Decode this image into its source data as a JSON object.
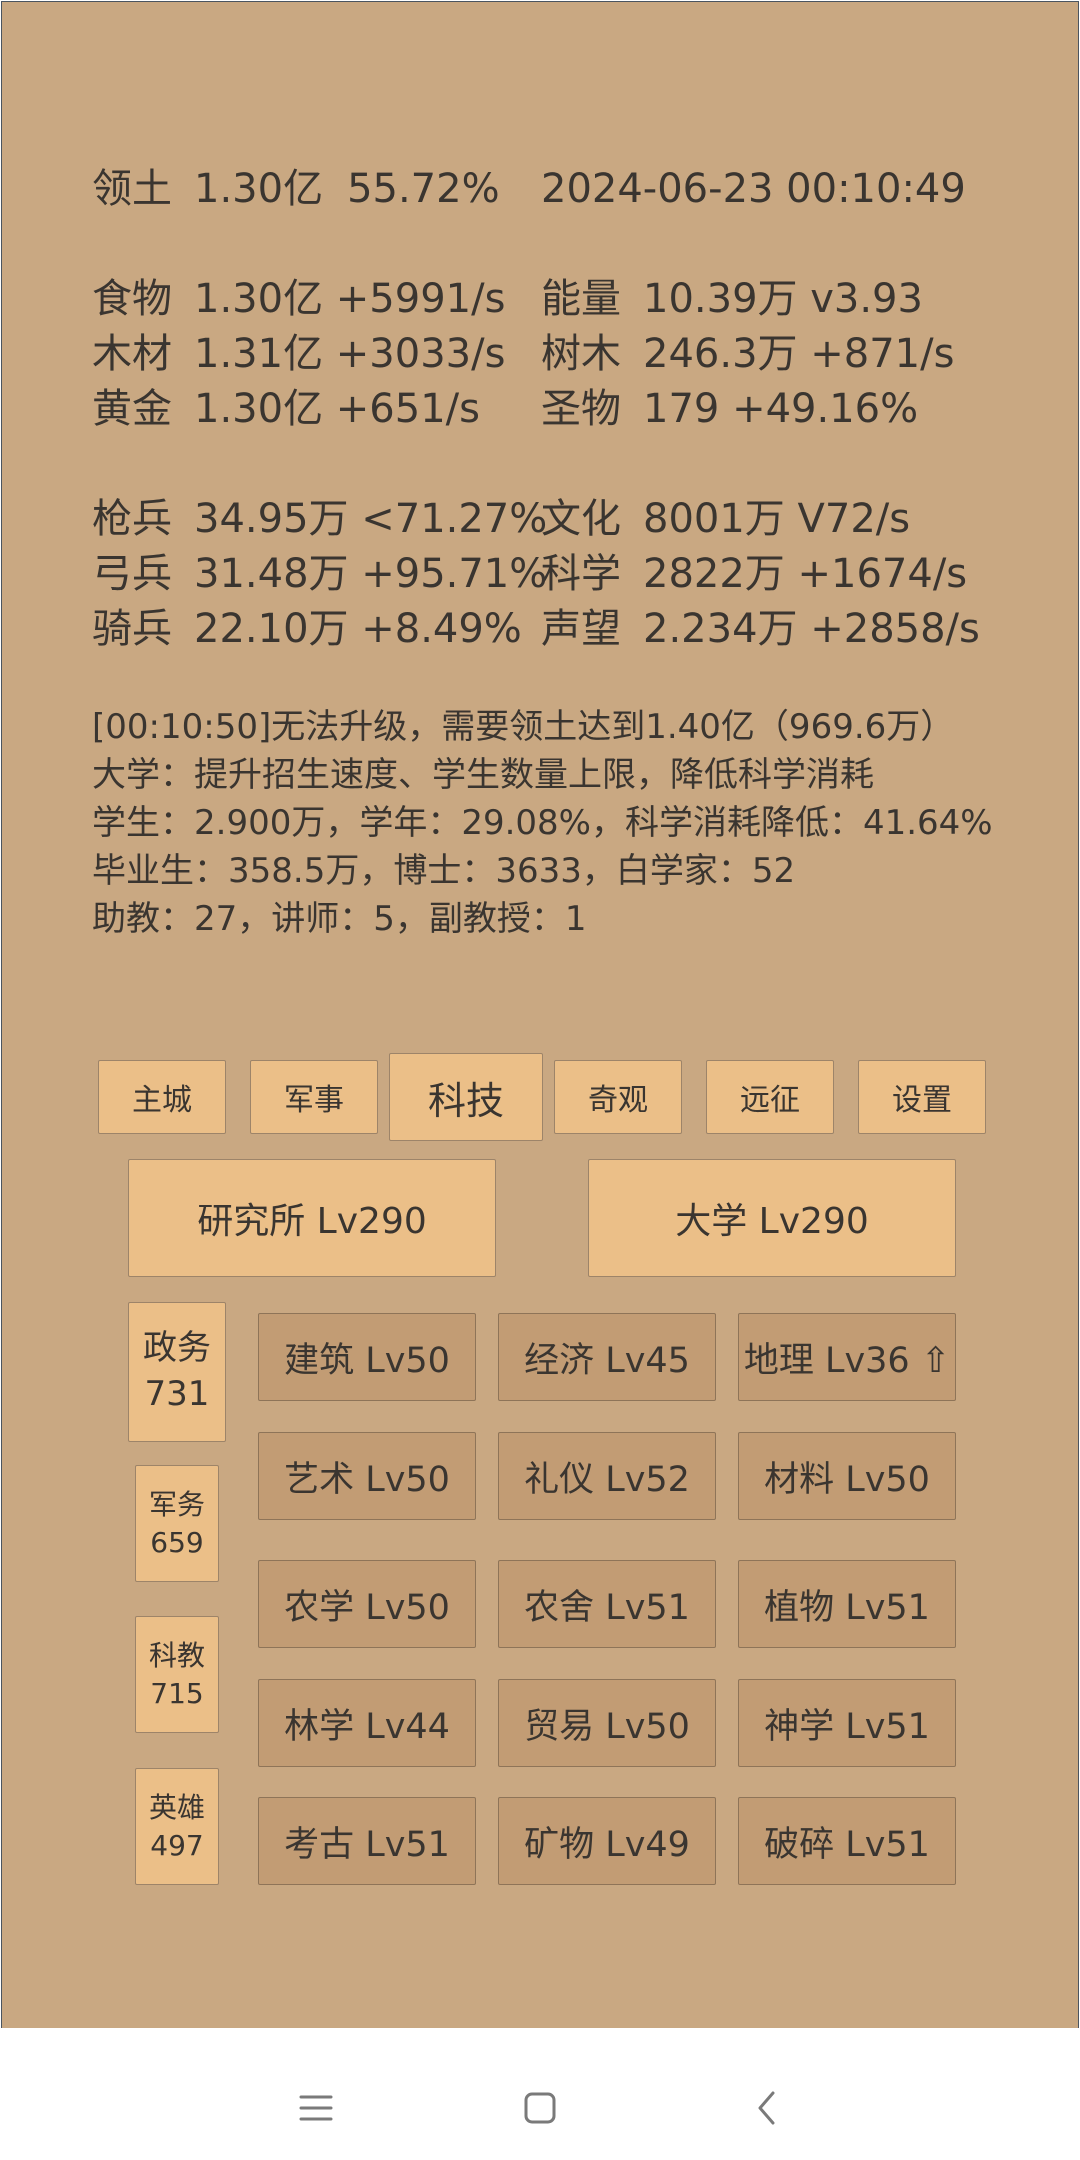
{
  "header": {
    "territory_label": "领土",
    "territory_value": "1.30亿",
    "territory_pct": "55.72%",
    "datetime": "2024-06-23 00:10:49"
  },
  "resources": [
    {
      "label": "食物",
      "value": "1.30亿 +5991/s"
    },
    {
      "label": "木材",
      "value": "1.31亿 +3033/s"
    },
    {
      "label": "黄金",
      "value": "1.30亿 +651/s"
    },
    {
      "label": "能量",
      "value": "10.39万  v3.93"
    },
    {
      "label": "树木",
      "value": "246.3万 +871/s"
    },
    {
      "label": "圣物",
      "value": "179 +49.16%"
    }
  ],
  "military": [
    {
      "label": "枪兵",
      "value": "34.95万 <71.27%"
    },
    {
      "label": "弓兵",
      "value": "31.48万 +95.71%"
    },
    {
      "label": "骑兵",
      "value": "22.10万 +8.49%"
    },
    {
      "label": "文化",
      "value": "8001万 V72/s"
    },
    {
      "label": "科学",
      "value": "2822万 +1674/s"
    },
    {
      "label": "声望",
      "value": "2.234万 +2858/s"
    }
  ],
  "info_lines": [
    "[00:10:50]无法升级，需要领土达到1.40亿（969.6万）",
    "大学：提升招生速度、学生数量上限，降低科学消耗",
    "学生：2.900万，学年：29.08%，科学消耗降低：41.64%",
    "毕业生：358.5万，博士：3633，白学家：52",
    "助教：27，讲师：5，副教授：1"
  ],
  "tabs": [
    "主城",
    "军事",
    "科技",
    "奇观",
    "远征",
    "设置"
  ],
  "buildings": [
    "研究所 Lv290",
    "大学 Lv290"
  ],
  "side_categories": [
    {
      "name": "政务",
      "count": "731"
    },
    {
      "name": "军务",
      "count": "659"
    },
    {
      "name": "科教",
      "count": "715"
    },
    {
      "name": "英雄",
      "count": "497"
    }
  ],
  "techs": [
    "建筑 Lv50",
    "经济 Lv45",
    "地理 Lv36 ⇧",
    "艺术 Lv50",
    "礼仪 Lv52",
    "材料 Lv50",
    "农学 Lv50",
    "农舍 Lv51",
    "植物 Lv51",
    "林学 Lv44",
    "贸易 Lv50",
    "神学 Lv51",
    "考古 Lv51",
    "矿物 Lv49",
    "破碎 Lv51"
  ],
  "colors": {
    "background": "#c9a882",
    "button": "#ebbf88",
    "tech_button": "#c29c74",
    "text": "#3a3530"
  },
  "navbar_icons": [
    "menu-icon",
    "home-icon",
    "back-icon"
  ]
}
